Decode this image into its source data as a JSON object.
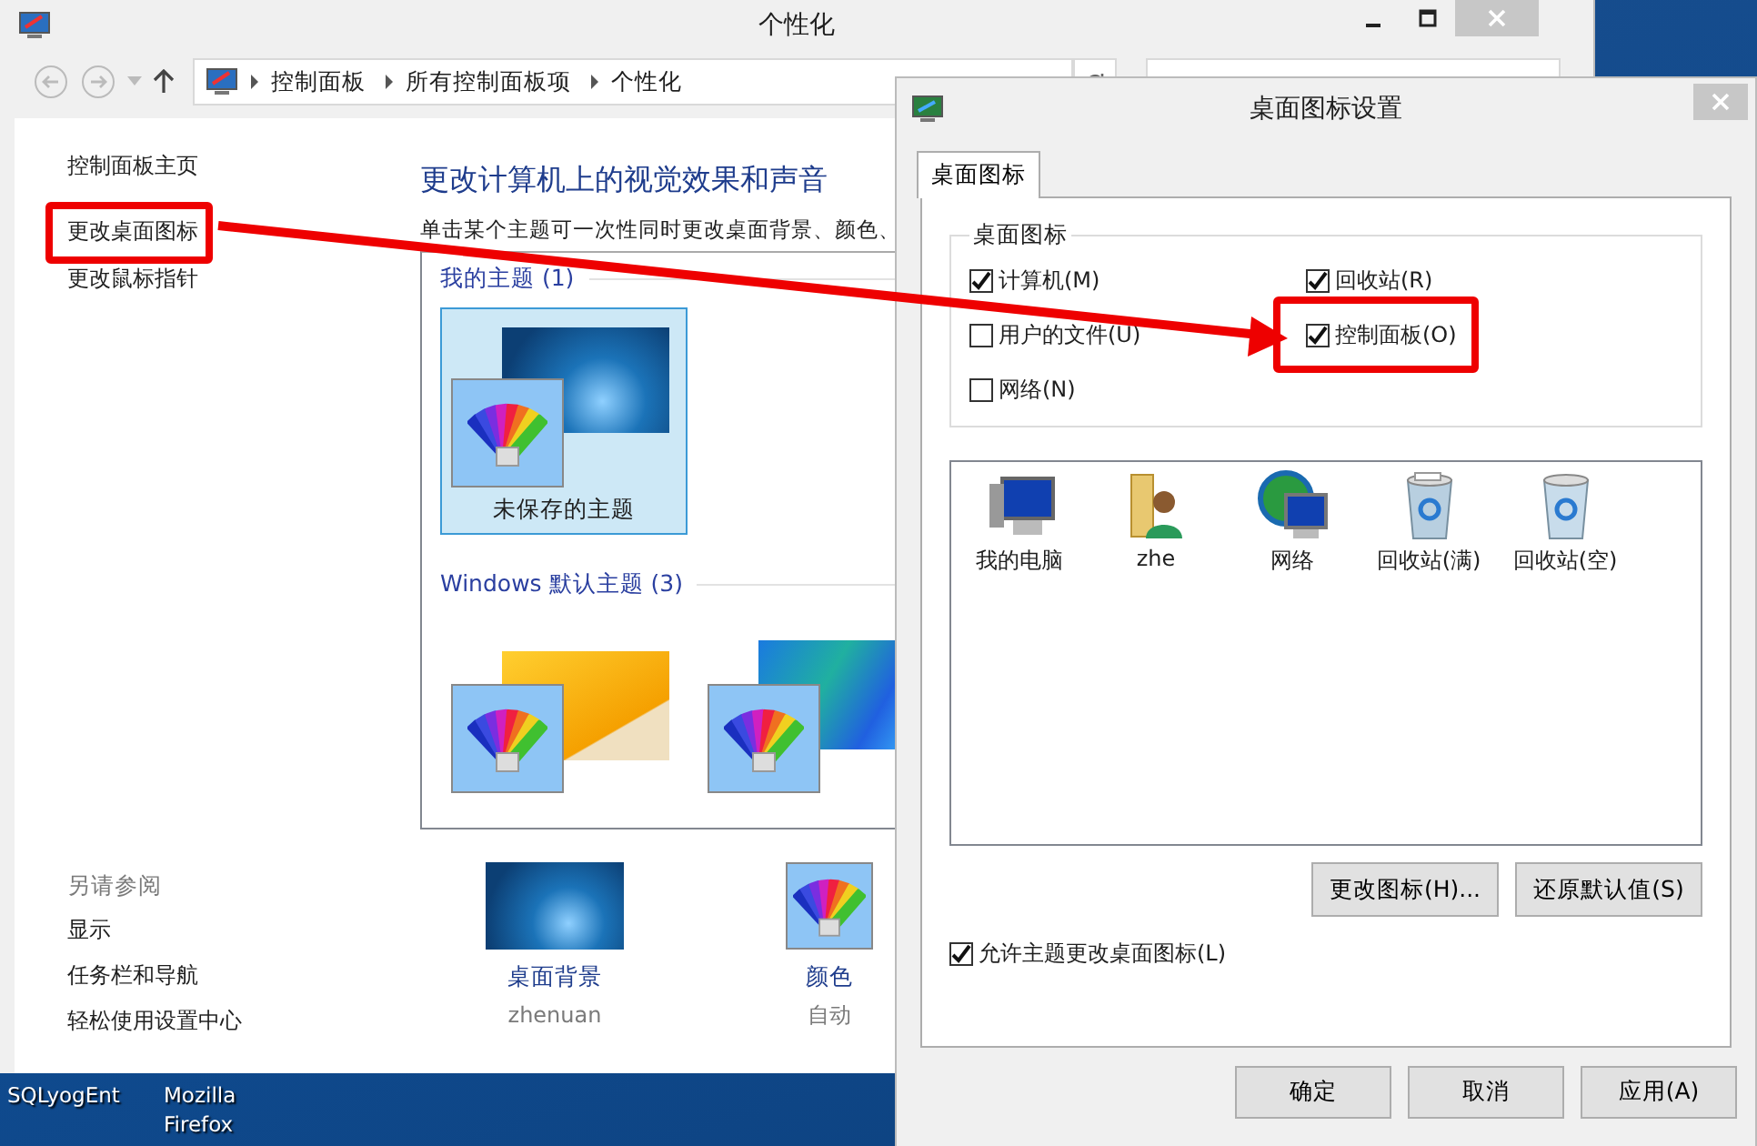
{
  "desktop": {
    "icons": [
      {
        "label": "SQLyogEnt"
      },
      {
        "label": "Mozilla Firefox"
      }
    ]
  },
  "main_window": {
    "title": "个性化",
    "breadcrumb": [
      "控制面板",
      "所有控制面板项",
      "个性化"
    ],
    "sidebar": {
      "links": [
        {
          "label": "控制面板主页",
          "highlighted": false
        },
        {
          "label": "更改桌面图标",
          "highlighted": true
        },
        {
          "label": "更改鼠标指针",
          "highlighted": false
        }
      ],
      "see_also_heading": "另请参阅",
      "see_also": [
        "显示",
        "任务栏和导航",
        "轻松使用设置中心"
      ]
    },
    "heading": "更改计算机上的视觉效果和声音",
    "description": "单击某个主题可一次性同时更改桌面背景、颜色、",
    "theme_groups": [
      {
        "title": "我的主题 (1)",
        "themes": [
          {
            "name": "未保存的主题",
            "kind": "starry",
            "selected": true
          }
        ]
      },
      {
        "title": "Windows 默认主题 (3)",
        "themes": [
          {
            "kind": "orange",
            "selected": false
          },
          {
            "kind": "stack",
            "selected": false
          }
        ]
      }
    ],
    "settings": [
      {
        "label": "桌面背景",
        "value": "zhenuan",
        "kind": "wallpaper"
      },
      {
        "label": "颜色",
        "value": "自动",
        "kind": "color"
      }
    ]
  },
  "dialog": {
    "title": "桌面图标设置",
    "tabs": [
      {
        "label": "桌面图标",
        "selected": true
      }
    ],
    "group_title": "桌面图标",
    "checkboxes": [
      {
        "label": "计算机(M)",
        "checked": true,
        "highlighted": false
      },
      {
        "label": "回收站(R)",
        "checked": true,
        "highlighted": false
      },
      {
        "label": "用户的文件(U)",
        "checked": false,
        "highlighted": false
      },
      {
        "label": "控制面板(O)",
        "checked": true,
        "highlighted": true
      },
      {
        "label": "网络(N)",
        "checked": false,
        "highlighted": false
      }
    ],
    "icons": [
      {
        "label": "我的电脑",
        "kind": "computer"
      },
      {
        "label": "zhe",
        "kind": "user-folder"
      },
      {
        "label": "网络",
        "kind": "network"
      },
      {
        "label": "回收站(满)",
        "kind": "bin-full"
      },
      {
        "label": "回收站(空)",
        "kind": "bin-empty"
      }
    ],
    "icon_buttons": [
      "更改图标(H)...",
      "还原默认值(S)"
    ],
    "allow_themes": {
      "label": "允许主题更改桌面图标(L)",
      "checked": true
    },
    "buttons": [
      "确定",
      "取消",
      "应用(A)"
    ]
  }
}
